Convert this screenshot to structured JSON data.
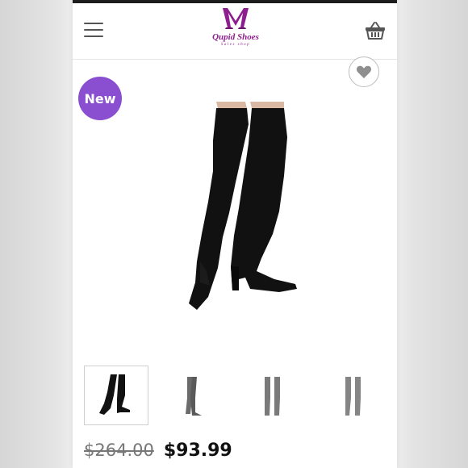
{
  "header": {
    "brand_name": "Qupid Shoes",
    "brand_tagline": "Sales shop",
    "accent_color": "#8e1e8e"
  },
  "icons": {
    "menu": "hamburger-menu-icon",
    "cart": "shopping-basket-icon",
    "wishlist": "heart-icon"
  },
  "product": {
    "badge": "New",
    "badge_color": "#8a4fd0",
    "thumbnails": [
      {
        "color": "#111111",
        "selected": true
      },
      {
        "color": "#6b6b6b",
        "selected": false
      },
      {
        "color": "#7a7a7a",
        "selected": false
      },
      {
        "color": "#858585",
        "selected": false
      }
    ],
    "price": {
      "original": "$264.00",
      "sale": "$93.99"
    }
  }
}
